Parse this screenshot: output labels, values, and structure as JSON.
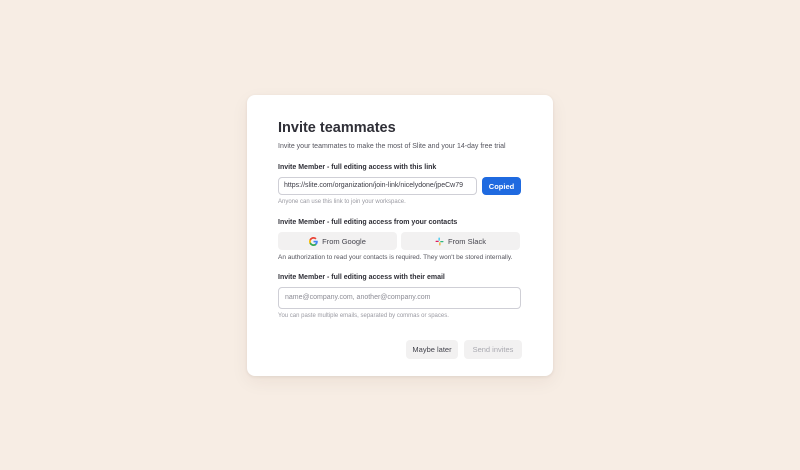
{
  "modal": {
    "title": "Invite teammates",
    "subtitle": "Invite your teammates to make the most of Slite and your 14-day free trial"
  },
  "link_section": {
    "label": "Invite Member - full editing access with this link",
    "link_value": "https://slite.com/organization/join-link/nicelydone/jpeCw79",
    "copy_button": "Copied",
    "hint": "Anyone can use this link to join your workspace."
  },
  "contacts_section": {
    "label": "Invite Member - full editing access from your contacts",
    "google_button": "From Google",
    "slack_button": "From Slack",
    "note": "An authorization to read your contacts is required. They won't be stored internally.",
    "icons": {
      "google": "google-icon",
      "slack": "slack-icon"
    }
  },
  "email_section": {
    "label": "Invite Member - full editing access with their email",
    "placeholder": "name@company.com, another@company.com",
    "hint": "You can paste multiple emails, separated by commas or spaces."
  },
  "footer": {
    "maybe_later": "Maybe later",
    "send_invites": "Send invites"
  },
  "colors": {
    "background": "#f7ede4",
    "accent": "#1f6ae0"
  }
}
